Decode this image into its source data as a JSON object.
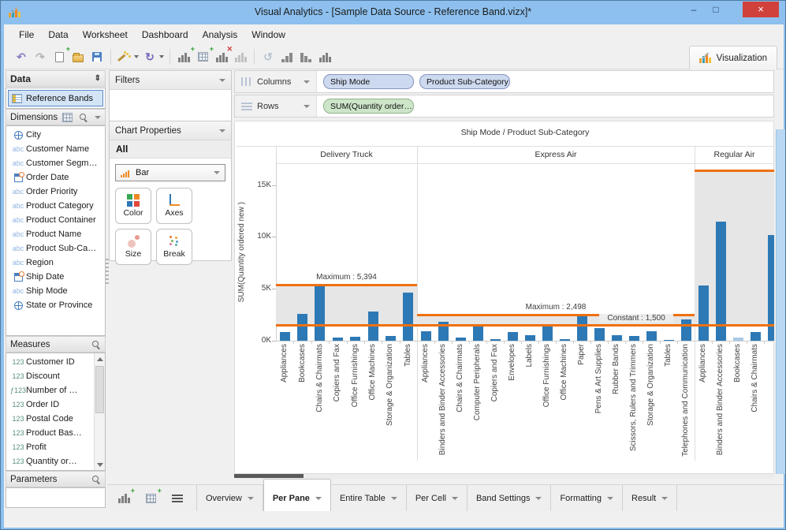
{
  "window": {
    "title": "Visual Analytics - [Sample Data Source - Reference Band.vizx]*",
    "controls": {
      "minimize": "–",
      "maximize": "□",
      "close": "×"
    }
  },
  "menu": {
    "items": [
      "File",
      "Data",
      "Worksheet",
      "Dashboard",
      "Analysis",
      "Window"
    ]
  },
  "toolbar": {
    "visualization_label": "Visualization",
    "items": [
      {
        "name": "undo-icon",
        "glyph": "↶",
        "color": "#8b80c4"
      },
      {
        "name": "redo-icon",
        "glyph": "↷",
        "color": "#b5b5b5"
      },
      {
        "name": "new-file-icon",
        "shape": "page",
        "badge": "+"
      },
      {
        "name": "open-file-icon",
        "shape": "folder"
      },
      {
        "name": "save-icon",
        "shape": "save"
      },
      {
        "name": "separator"
      },
      {
        "name": "wand-icon",
        "shape": "wand",
        "dropdown": true
      },
      {
        "name": "refresh-icon",
        "glyph": "↻",
        "color": "#7568bd",
        "dropdown": true
      },
      {
        "name": "separator"
      },
      {
        "name": "add-chart-icon",
        "shape": "bars",
        "badge": "+"
      },
      {
        "name": "add-crosstab-icon",
        "shape": "grid",
        "badge": "+"
      },
      {
        "name": "remove-chart-icon",
        "shape": "bars",
        "badge": "x"
      },
      {
        "name": "chart-disabled-icon",
        "shape": "bars-light"
      },
      {
        "name": "separator"
      },
      {
        "name": "select-rotate-icon",
        "glyph": "↺",
        "color": "#b8c4d0"
      },
      {
        "name": "sort-ascending-icon",
        "shape": "sort-asc"
      },
      {
        "name": "sort-descending-icon",
        "shape": "sort-desc"
      },
      {
        "name": "chart-label-icon",
        "shape": "bars",
        "badge": ""
      }
    ]
  },
  "data_panel": {
    "header": "Data",
    "source_name": "Reference Bands",
    "dimensions": {
      "header": "Dimensions",
      "items": [
        {
          "label": "City",
          "icon": "globe"
        },
        {
          "label": "Customer Name",
          "icon": "abc"
        },
        {
          "label": "Customer Segm…",
          "icon": "abc"
        },
        {
          "label": "Order Date",
          "icon": "date"
        },
        {
          "label": "Order Priority",
          "icon": "abc"
        },
        {
          "label": "Product Category",
          "icon": "abc"
        },
        {
          "label": "Product Container",
          "icon": "abc"
        },
        {
          "label": "Product Name",
          "icon": "abc"
        },
        {
          "label": "Product Sub-Ca…",
          "icon": "abc"
        },
        {
          "label": "Region",
          "icon": "abc"
        },
        {
          "label": "Ship Date",
          "icon": "date"
        },
        {
          "label": "Ship Mode",
          "icon": "abc"
        },
        {
          "label": "State or Province",
          "icon": "globe"
        }
      ]
    },
    "measures": {
      "header": "Measures",
      "items": [
        {
          "label": "Customer ID",
          "icon": "num"
        },
        {
          "label": "Discount",
          "icon": "num"
        },
        {
          "label": "Number of …",
          "icon": "fnum"
        },
        {
          "label": "Order ID",
          "icon": "num"
        },
        {
          "label": "Postal Code",
          "icon": "num"
        },
        {
          "label": "Product Bas…",
          "icon": "num"
        },
        {
          "label": "Profit",
          "icon": "num"
        },
        {
          "label": "Quantity or…",
          "icon": "num"
        }
      ]
    },
    "parameters": {
      "header": "Parameters"
    }
  },
  "filters_panel": {
    "header": "Filters"
  },
  "chart_properties": {
    "header": "Chart Properties",
    "scope": "All",
    "chart_type": "Bar",
    "buttons": [
      {
        "label": "Color",
        "icon": "color"
      },
      {
        "label": "Axes",
        "icon": "axes"
      },
      {
        "label": "Size",
        "icon": "size"
      },
      {
        "label": "Break",
        "icon": "break"
      }
    ]
  },
  "shelves": {
    "columns": {
      "label": "Columns",
      "pills": [
        "Ship Mode",
        "Product Sub-Category"
      ]
    },
    "rows": {
      "label": "Rows",
      "pills": [
        "SUM(Quantity order…"
      ]
    }
  },
  "tabs": {
    "items": [
      "Overview",
      "Per Pane",
      "Entire Table",
      "Per Cell",
      "Band Settings",
      "Formatting",
      "Result"
    ],
    "selected": "Per Pane"
  },
  "chart_data": {
    "type": "bar",
    "title": "Ship Mode / Product Sub-Category",
    "ylabel": "SUM(Quantity ordered new )",
    "ytick_labels": [
      "0K",
      "5K",
      "10K",
      "15K"
    ],
    "ytick_values": [
      0,
      5000,
      10000,
      15000
    ],
    "ylim": [
      0,
      17100
    ],
    "bar_color": "#2d79b5",
    "bar_color_light": "#a8cbe6",
    "band_color": "#e6e6e6",
    "line_color": "#f07010",
    "legend": "none",
    "grid": false,
    "panes": [
      {
        "name": "Delivery Truck",
        "band": {
          "min": 1500,
          "max": 5394,
          "max_label": "Maximum : 5,394",
          "min_label": null
        },
        "categories": [
          "Appliances",
          "Bookcases",
          "Chairs & Chairmats",
          "Copiers and Fax",
          "Office Furnishings",
          "Office Machines",
          "Storage & Organization",
          "Tables"
        ],
        "values": [
          800,
          2600,
          5394,
          280,
          380,
          2800,
          430,
          4600
        ]
      },
      {
        "name": "Express Air",
        "band": {
          "min": 1500,
          "max": 2498,
          "max_label": "Maximum : 2,498",
          "min_label": "Constant : 1,500"
        },
        "categories": [
          "Appliances",
          "Binders and Binder Accessories",
          "Chairs & Chairmats",
          "Computer Peripherals",
          "Copiers and Fax",
          "Envelopes",
          "Labels",
          "Office Furnishings",
          "Office Machines",
          "Paper",
          "Pens & Art Supplies",
          "Rubber Bands",
          "Scissors, Rulers and Trimmers",
          "Storage & Organization",
          "Tables",
          "Telephones and Communication"
        ],
        "values": [
          930,
          1800,
          300,
          1450,
          180,
          820,
          560,
          1580,
          150,
          2498,
          1220,
          550,
          480,
          890,
          100,
          2080
        ]
      },
      {
        "name": "Regular Air",
        "band": {
          "min": 1500,
          "max": 16340,
          "max_label": null,
          "min_label": null
        },
        "categories": [
          "Appliances",
          "Binders and Binder Accessories",
          "Bookcases",
          "Chairs & Chairmats",
          ""
        ],
        "values": [
          5340,
          11450,
          300,
          820,
          10150
        ],
        "highlight_index": 2
      }
    ]
  }
}
